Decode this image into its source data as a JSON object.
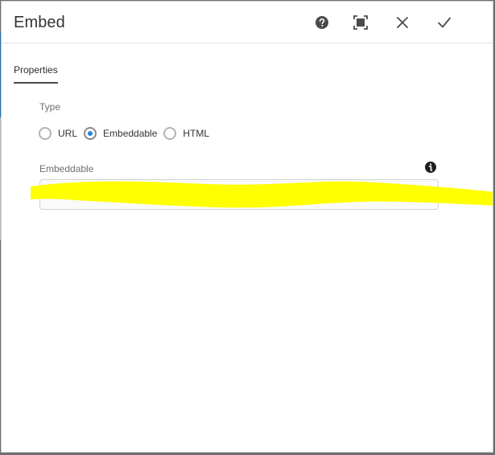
{
  "dialog": {
    "title": "Embed",
    "header_icons": {
      "help": "help-icon",
      "fullscreen": "fullscreen-icon",
      "close": "close-icon",
      "done": "check-icon"
    }
  },
  "tabs": [
    {
      "label": "Properties",
      "active": true
    }
  ],
  "form": {
    "type_label": "Type",
    "radio_options": [
      {
        "label": "URL",
        "checked": false
      },
      {
        "label": "Embeddable",
        "checked": true
      },
      {
        "label": "HTML",
        "checked": false
      }
    ],
    "embeddable_label": "Embeddable",
    "embeddable_value": "",
    "info_icon": "info-icon"
  },
  "colors": {
    "accent": "#2680eb",
    "highlight": "#ffff00"
  }
}
